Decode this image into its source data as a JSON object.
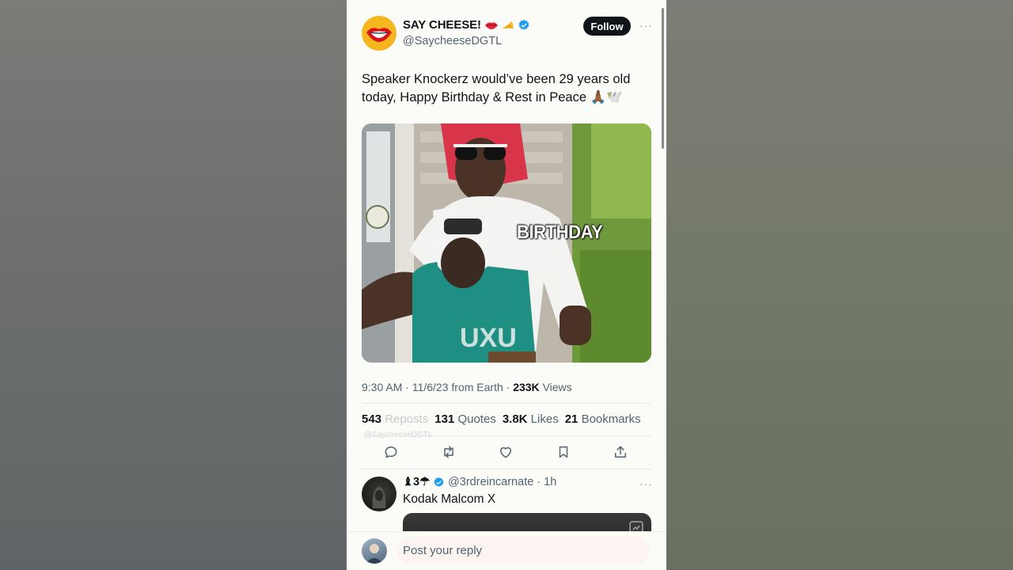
{
  "tweet": {
    "display_name": "SAY CHEESE!",
    "handle": "@SaycheeseDGTL",
    "follow_label": "Follow",
    "more_label": "···",
    "text": "Speaker Knockerz would’ve been 29 years old today, Happy Birthday & Rest in Peace 🙏🏾🕊️",
    "image_caption": "BIRTHDAY",
    "time": "9:30 AM",
    "date": "11/6/23",
    "location": "from Earth",
    "views_count": "233K",
    "views_label": "Views",
    "reposts_count": "543",
    "reposts_label": "Reposts",
    "quotes_count": "131",
    "quotes_label": "Quotes",
    "likes_count": "3.8K",
    "likes_label": "Likes",
    "bookmarks_count": "21",
    "bookmarks_label": "Bookmarks",
    "watermark": "@SaycheeseDGTL"
  },
  "reply": {
    "display_name": "♝3☂",
    "handle": "@3rdreincarnate",
    "time": "1h",
    "text": "Kodak Malcom X",
    "more_label": "···"
  },
  "composer": {
    "placeholder": "Post your reply"
  },
  "colors": {
    "verified": "#1d9bf0",
    "text_primary": "#0f1419",
    "text_secondary": "#536471",
    "icon": "#536471"
  },
  "icons": [
    "verified-badge-icon",
    "reply-icon",
    "repost-icon",
    "like-icon",
    "bookmark-icon",
    "share-icon",
    "more-icon",
    "media-icon"
  ]
}
